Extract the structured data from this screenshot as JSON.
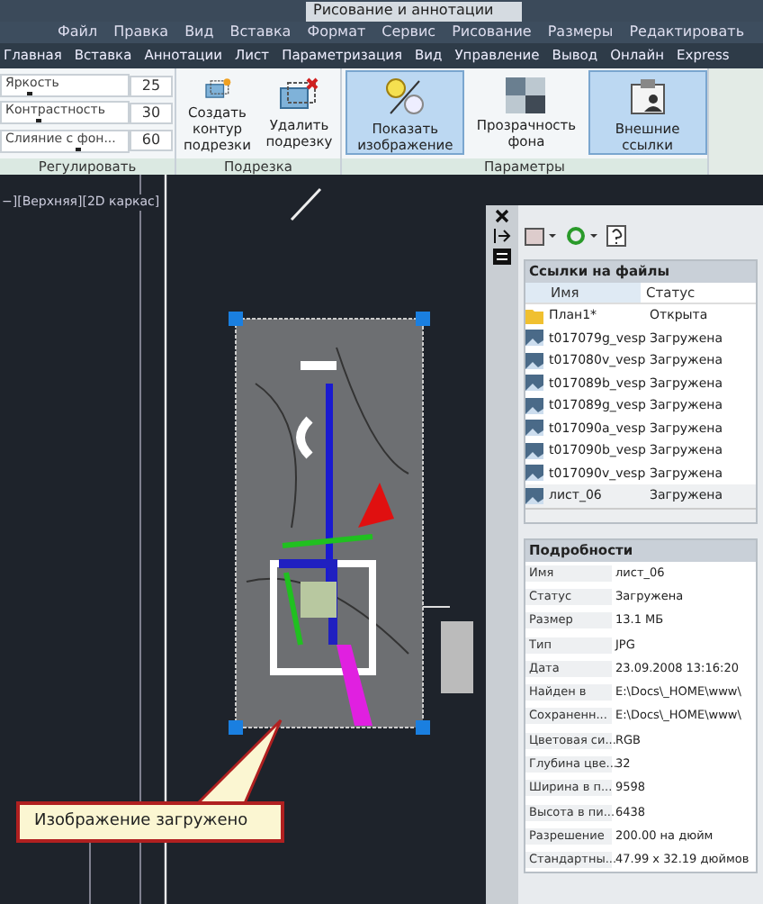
{
  "quick_access": {
    "workspace": "Рисование и аннотации"
  },
  "menu": [
    "Файл",
    "Правка",
    "Вид",
    "Вставка",
    "Формат",
    "Сервис",
    "Рисование",
    "Размеры",
    "Редактировать"
  ],
  "ribbon_tabs": [
    "Главная",
    "Вставка",
    "Аннотации",
    "Лист",
    "Параметризация",
    "Вид",
    "Управление",
    "Вывод",
    "Онлайн",
    "Express"
  ],
  "ribbon": {
    "adjust": {
      "label": "Регулировать",
      "sliders": [
        {
          "name": "Яркость",
          "value": "25",
          "level": 0.2
        },
        {
          "name": "Контрастность",
          "value": "30",
          "level": 0.28
        },
        {
          "name": "Слияние с фон...",
          "value": "60",
          "level": 0.6
        }
      ]
    },
    "clip": {
      "label": "Подрезка",
      "buttons": [
        {
          "kind": "create",
          "label": "Создать контур подрезки"
        },
        {
          "kind": "delete",
          "label": "Удалить подрезку"
        }
      ]
    },
    "options": {
      "label": "Параметры",
      "buttons": [
        {
          "kind": "show",
          "label": "Показать изображение",
          "selected": true
        },
        {
          "kind": "transparency",
          "label": "Прозрачность фона",
          "selected": false
        },
        {
          "kind": "xref",
          "label": "Внешние ссылки",
          "selected": true
        }
      ]
    }
  },
  "viewport": {
    "label": "−][Верхняя][2D каркас]"
  },
  "callout": {
    "text": "Изображение загружено"
  },
  "palette": {
    "files": {
      "title": "Ссылки на файлы",
      "columns": [
        "Имя",
        "Статус"
      ],
      "rows": [
        {
          "kind": "sheet",
          "name": "План1*",
          "status": "Открыта",
          "selected": false
        },
        {
          "kind": "image",
          "name": "t017079g_vesp",
          "status": "Загружена",
          "selected": false
        },
        {
          "kind": "image",
          "name": "t017080v_vesp",
          "status": "Загружена",
          "selected": false
        },
        {
          "kind": "image",
          "name": "t017089b_vesp",
          "status": "Загружена",
          "selected": false
        },
        {
          "kind": "image",
          "name": "t017089g_vesp",
          "status": "Загружена",
          "selected": false
        },
        {
          "kind": "image",
          "name": "t017090a_vesp",
          "status": "Загружена",
          "selected": false
        },
        {
          "kind": "image",
          "name": "t017090b_vesp",
          "status": "Загружена",
          "selected": false
        },
        {
          "kind": "image",
          "name": "t017090v_vesp",
          "status": "Загружена",
          "selected": false
        },
        {
          "kind": "image",
          "name": "лист_06",
          "status": "Загружена",
          "selected": true
        }
      ]
    },
    "details": {
      "title": "Подробности",
      "rows": [
        {
          "key": "Имя",
          "value": "лист_06"
        },
        {
          "key": "Статус",
          "value": "Загружена"
        },
        {
          "key": "Размер",
          "value": "13.1 МБ"
        },
        {
          "key": "Тип",
          "value": "JPG"
        },
        {
          "key": "Дата",
          "value": "23.09.2008 13:16:20"
        },
        {
          "key": "Найден в",
          "value": "E:\\Docs\\_HOME\\www\\"
        },
        {
          "key": "Сохраненн...",
          "value": "E:\\Docs\\_HOME\\www\\"
        },
        {
          "key": "Цветовая си...",
          "value": "RGB"
        },
        {
          "key": "Глубина цве...",
          "value": "32"
        },
        {
          "key": "Ширина в п...",
          "value": "9598"
        },
        {
          "key": "Высота в пи...",
          "value": "6438"
        },
        {
          "key": "Разрешение",
          "value": "200.00 на дюйм"
        },
        {
          "key": "Стандартны...",
          "value": "47.99 x 32.19 дюймов"
        }
      ]
    }
  }
}
